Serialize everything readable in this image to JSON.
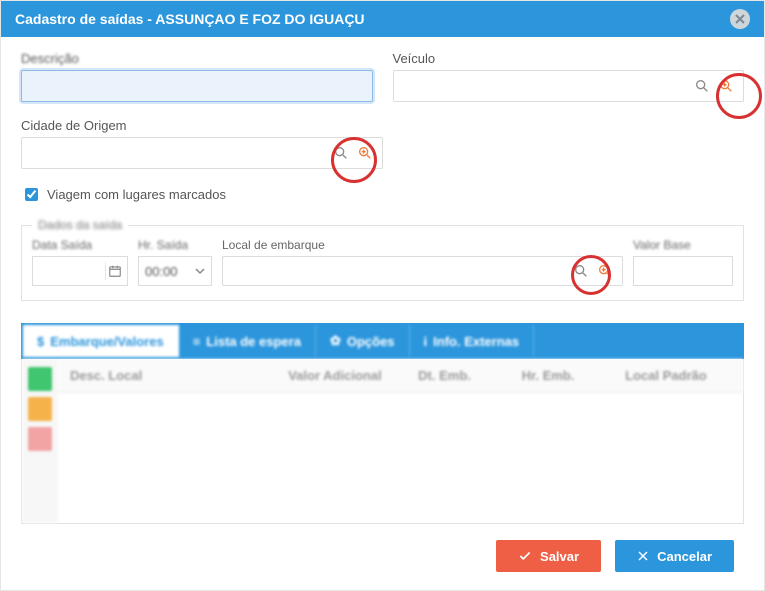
{
  "title": "Cadastro de saídas - ASSUNÇAO E FOZ DO IGUAÇU",
  "fields": {
    "descricao_label": "Descrição",
    "descricao_value": "",
    "veiculo_label": "Veículo",
    "veiculo_value": "",
    "cidade_label": "Cidade de Origem",
    "cidade_value": "",
    "checkbox_label": "Viagem com lugares marcados",
    "checkbox_checked": true
  },
  "dados": {
    "legend": "Dados da saída",
    "data_saida_label": "Data Saída",
    "hr_saida_label": "Hr. Saída",
    "hr_saida_value": "00:00",
    "local_embarque_label": "Local de embarque",
    "local_embarque_value": "",
    "valor_base_label": "Valor Base",
    "valor_base_value": ""
  },
  "tabs": [
    {
      "label": "Embarque/Valores",
      "icon": "$"
    },
    {
      "label": "Lista de espera",
      "icon": "≡"
    },
    {
      "label": "Opções",
      "icon": "✿"
    },
    {
      "label": "Info. Externas",
      "icon": "i"
    }
  ],
  "grid_headers": {
    "desc_local": "Desc. Local",
    "valor_adicional": "Valor Adicional",
    "dt_emb": "Dt. Emb.",
    "hr_emb": "Hr. Emb.",
    "local_padrao": "Local Padrão"
  },
  "buttons": {
    "save": "Salvar",
    "cancel": "Cancelar"
  }
}
